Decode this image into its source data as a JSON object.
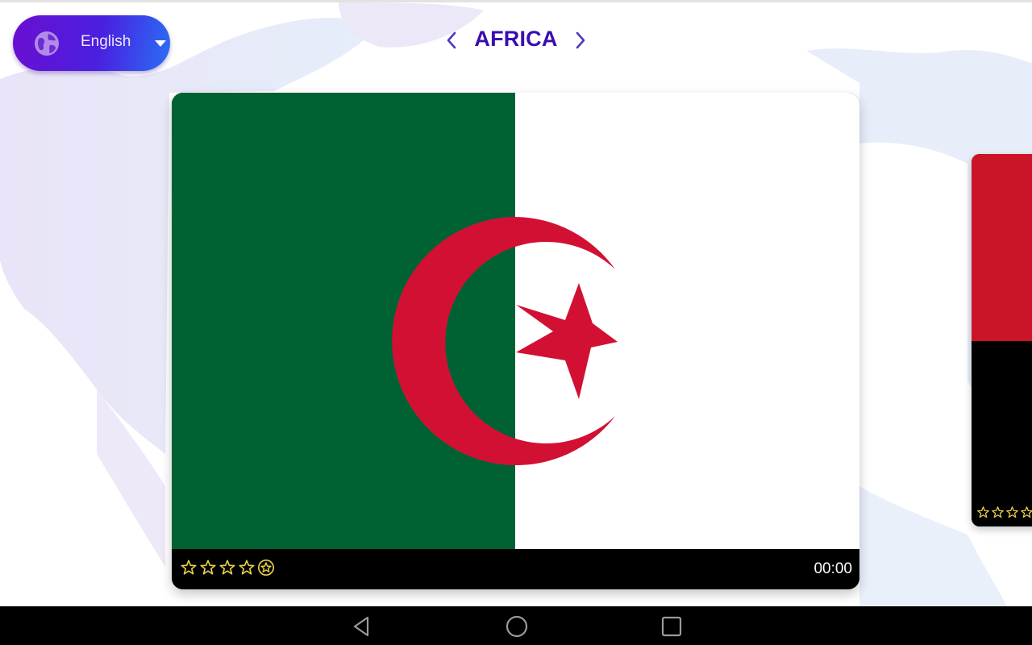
{
  "language_selector": {
    "icon": "globe-icon",
    "selected": "English",
    "dropdown_icon": "caret-down-icon"
  },
  "region": {
    "title": "AFRICA",
    "prev_icon": "chevron-left-icon",
    "next_icon": "chevron-right-icon"
  },
  "current_card": {
    "flag": "Algeria",
    "flag_colors": {
      "green": "#006233",
      "white": "#ffffff",
      "red": "#d21034"
    },
    "rating": {
      "stars_total": 5,
      "icons": [
        "star-outline",
        "star-outline",
        "star-outline",
        "star-outline",
        "star-badge"
      ]
    },
    "timer": "00:00"
  },
  "next_card": {
    "flag_colors": {
      "top": "#cc1428",
      "bottom": "#000000"
    },
    "rating": {
      "stars_visible": 4
    }
  },
  "colors": {
    "title": "#3a0db0",
    "star": "#e8cf4a",
    "footer": "#000000"
  },
  "system_nav": {
    "buttons": [
      "back",
      "home",
      "recents"
    ]
  }
}
